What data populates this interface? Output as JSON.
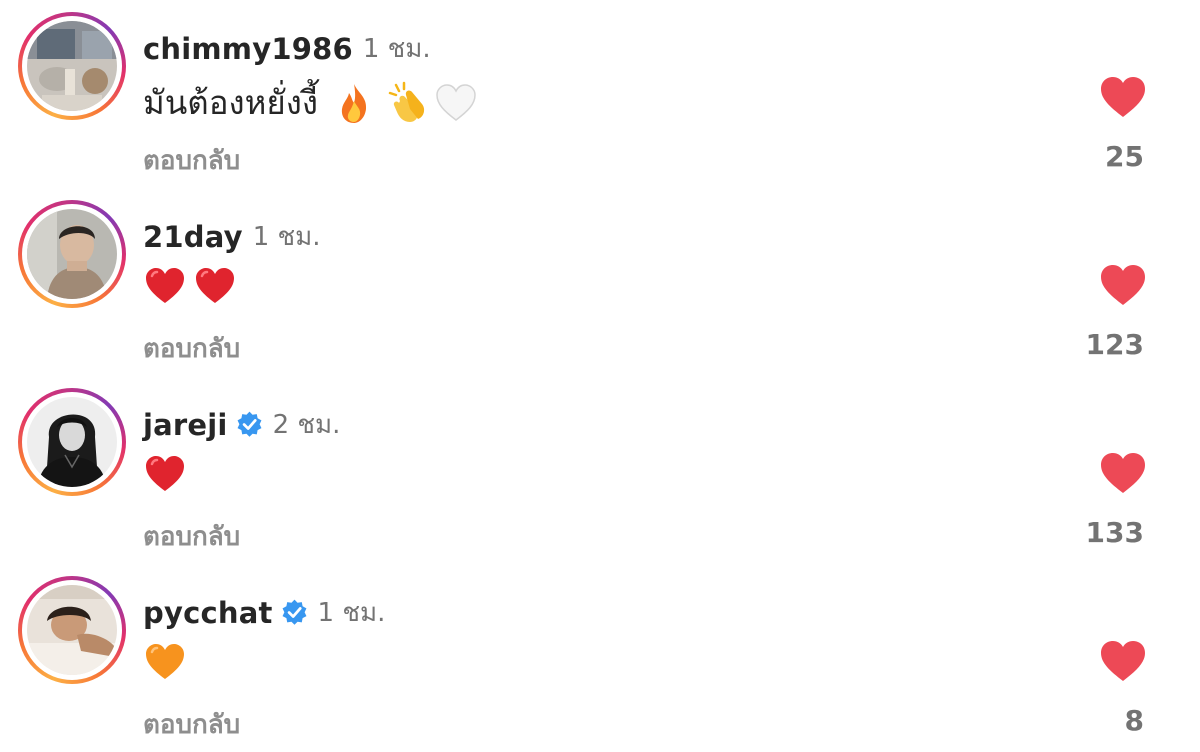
{
  "colors": {
    "like_heart": "#ed4956",
    "verified_badge": "#3897f0",
    "username": "#262626",
    "secondary_text": "#737373"
  },
  "comments": [
    {
      "username": "chimmy1986",
      "verified": false,
      "time": "1 ชม.",
      "text": "มันต้องหยั่งงี้",
      "emojis": [
        "fire-emoji",
        "clapping-hands-emoji",
        "white-heart-emoji"
      ],
      "reply_label": "ตอบกลับ",
      "likes": "25"
    },
    {
      "username": "21day",
      "verified": false,
      "time": "1 ชม.",
      "text": "",
      "emojis": [
        "red-heart-emoji",
        "red-heart-emoji"
      ],
      "reply_label": "ตอบกลับ",
      "likes": "123"
    },
    {
      "username": "jareji",
      "verified": true,
      "time": "2 ชม.",
      "text": "",
      "emojis": [
        "red-heart-emoji"
      ],
      "reply_label": "ตอบกลับ",
      "likes": "133"
    },
    {
      "username": "pycchat",
      "verified": true,
      "time": "1 ชม.",
      "text": "",
      "emojis": [
        "orange-heart-emoji"
      ],
      "reply_label": "ตอบกลับ",
      "likes": "8"
    }
  ]
}
